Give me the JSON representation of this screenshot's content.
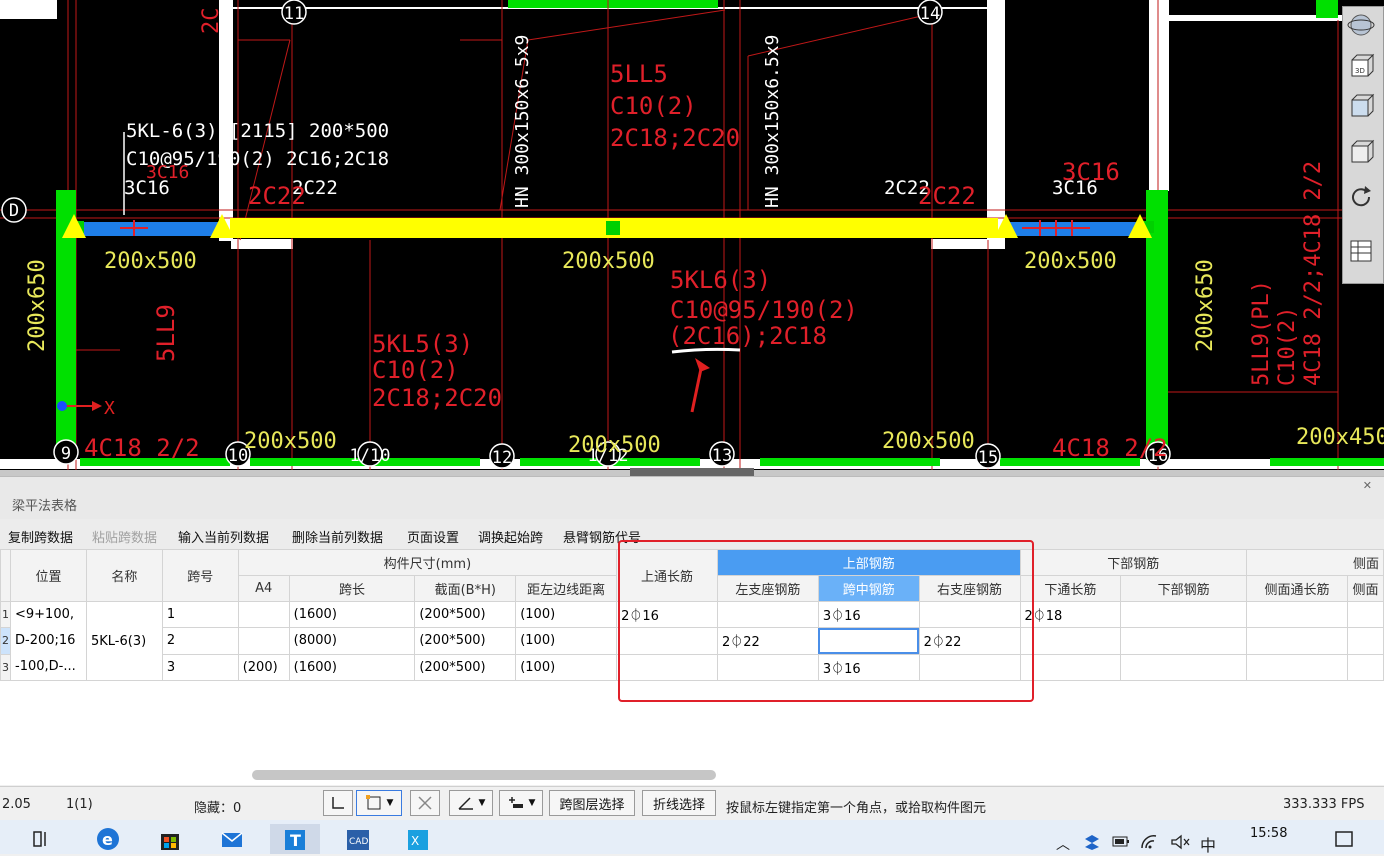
{
  "cad": {
    "axes": [
      {
        "label": "11"
      },
      {
        "label": "14"
      },
      {
        "label": "D"
      },
      {
        "label": "9"
      },
      {
        "label": "10"
      },
      {
        "label": "1/10"
      },
      {
        "label": "12"
      },
      {
        "label": "1/12"
      },
      {
        "label": "13"
      },
      {
        "label": "15"
      },
      {
        "label": "16"
      }
    ],
    "labels_white": [
      "5KL-6(3) [2115] 200*500",
      "C10@95/190(2) 2C16;2C18",
      "3C16",
      "2C22",
      "2C22",
      "3C16"
    ],
    "labels_yellow": [
      "200x500",
      "200x500",
      "200x500",
      "200x650",
      "200x650",
      "200x500",
      "200x500",
      "200x500",
      "200x450"
    ],
    "labels_red": [
      "5LL5",
      "C10(2)",
      "2C18;2C20",
      "5KL6(3)",
      "C10@95/190(2)",
      "(2C16);2C18",
      "5KL5(3)",
      "C10(2)",
      "2C18;2C20",
      "5LL9",
      "4C18 2/2",
      "4C18 2/2",
      "3C16",
      "2C22",
      "2C22",
      "5LL9(PL)",
      "C10(2)",
      "4C18 2/2;4C18 2/2",
      "3C16",
      "2C"
    ],
    "labels_vertical_white": [
      "HN 300x150x6.5x9",
      "HN 300x150x6.5x9"
    ],
    "ucs_label": "X"
  },
  "panel": {
    "title": "梁平法表格",
    "toolbar": [
      {
        "label": "复制跨数据",
        "enabled": true
      },
      {
        "label": "粘贴跨数据",
        "enabled": false
      },
      {
        "label": "输入当前列数据",
        "enabled": true
      },
      {
        "label": "删除当前列数据",
        "enabled": true
      },
      {
        "label": "页面设置",
        "enabled": true
      },
      {
        "label": "调换起始跨",
        "enabled": true
      },
      {
        "label": "悬臂钢筋代号",
        "enabled": true
      }
    ],
    "headers": {
      "position": "位置",
      "name": "名称",
      "span": "跨号",
      "size_group": "构件尺寸(mm)",
      "a4": "A4",
      "span_len": "跨长",
      "section": "截面(B*H)",
      "edge": "距左边线距离",
      "top_through": "上通长筋",
      "top_group": "上部钢筋",
      "left_support": "左支座钢筋",
      "mid_span": "跨中钢筋",
      "right_support": "右支座钢筋",
      "bottom_group": "下部钢筋",
      "bottom_through": "下通长筋",
      "bottom_bar": "下部钢筋",
      "side_group": "侧面",
      "side_through": "侧面通长筋",
      "side_extra": "侧面"
    },
    "position_value": "<9+100, D-200;16 -100,D-...",
    "name_value": "5KL-6(3)",
    "rows": [
      {
        "num": "1",
        "span": "1",
        "a4": "",
        "span_len": "(1600)",
        "section": "(200*500)",
        "edge": "(100)",
        "top_through": "2⏀16",
        "left_support": "",
        "mid_span": "3⏀16",
        "right_support": "",
        "bottom_through": "2⏀18",
        "bottom_bar": "",
        "side_through": "",
        "side_extra": ""
      },
      {
        "num": "2",
        "span": "2",
        "a4": "",
        "span_len": "(8000)",
        "section": "(200*500)",
        "edge": "(100)",
        "top_through": "",
        "left_support": "2⏀22",
        "mid_span": "",
        "right_support": "2⏀22",
        "bottom_through": "",
        "bottom_bar": "",
        "side_through": "",
        "side_extra": ""
      },
      {
        "num": "3",
        "span": "3",
        "a4": "(200)",
        "span_len": "(1600)",
        "section": "(200*500)",
        "edge": "(100)",
        "top_through": "",
        "left_support": "",
        "mid_span": "3⏀16",
        "right_support": "",
        "bottom_through": "",
        "bottom_bar": "",
        "side_through": "",
        "side_extra": ""
      }
    ]
  },
  "status": {
    "coord": "2.05",
    "ratio": "1(1)",
    "hidden": "隐藏：0",
    "btn_layer": "跨图层选择",
    "btn_polyline": "折线选择",
    "hint": "按鼠标左键指定第一个角点，或拾取构件图元",
    "fps": "333.333 FPS"
  },
  "taskbar": {
    "time": "15:58",
    "ime": "中"
  },
  "colors": {
    "accent_red": "#e0202a",
    "header_blue": "#6ab1f8",
    "beam_yellow": "#ffff00",
    "cad_green": "#00e000",
    "cad_red": "#e0202a"
  }
}
